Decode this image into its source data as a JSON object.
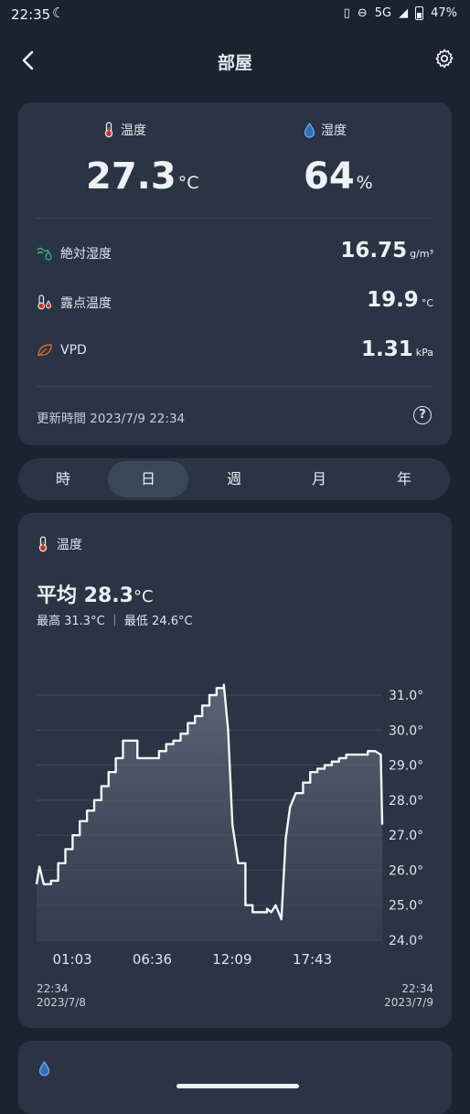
{
  "status": {
    "time": "22:35",
    "network": "5G",
    "battery": "47%"
  },
  "appbar": {
    "title": "部屋"
  },
  "summary": {
    "temp_label": "温度",
    "temp_value": "27.3",
    "temp_unit": "°C",
    "hum_label": "湿度",
    "hum_value": "64",
    "hum_unit": "%",
    "rows": [
      {
        "label": "絶対湿度",
        "value": "16.75",
        "unit": "g/m³"
      },
      {
        "label": "露点温度",
        "value": "19.9",
        "unit": "°C"
      },
      {
        "label": "VPD",
        "value": "1.31",
        "unit": "kPa"
      }
    ],
    "updated": "更新時間 2023/7/9 22:34",
    "help": "?"
  },
  "tabs": [
    {
      "label": "時",
      "active": false
    },
    {
      "label": "日",
      "active": true
    },
    {
      "label": "週",
      "active": false
    },
    {
      "label": "月",
      "active": false
    },
    {
      "label": "年",
      "active": false
    }
  ],
  "chart_card": {
    "label": "温度",
    "avg_label": "平均 28.3",
    "avg_unit": "°C",
    "minmax": "最高 31.3°C ｜ 最低 24.6°C",
    "range_start_time": "22:34",
    "range_start_date": "2023/7/8",
    "range_end_time": "22:34",
    "range_end_date": "2023/7/9"
  },
  "chart_data": {
    "type": "area",
    "ylim": [
      24.0,
      31.0
    ],
    "yticks": [
      "31.0°",
      "30.0°",
      "29.0°",
      "28.0°",
      "27.0°",
      "26.0°",
      "25.0°",
      "24.0°"
    ],
    "xticks": [
      "01:03",
      "06:36",
      "12:09",
      "17:43"
    ],
    "x_hours": [
      0,
      0.2,
      0.5,
      1,
      1.5,
      2,
      2.5,
      3,
      3.5,
      4,
      4.5,
      5,
      5.5,
      6,
      6.5,
      7,
      7.5,
      8,
      8.5,
      9,
      9.5,
      10,
      10.5,
      11,
      11.5,
      12,
      12.5,
      13,
      13.3,
      13.6,
      14,
      14.5,
      15,
      15.5,
      16,
      16.3,
      16.6,
      17,
      17.3,
      17.6,
      18,
      18.5,
      19,
      19.5,
      20,
      20.5,
      21,
      21.5,
      22,
      22.5,
      23,
      23.5,
      23.9,
      24
    ],
    "values": [
      25.6,
      26.1,
      25.6,
      25.7,
      26.2,
      26.6,
      27.0,
      27.4,
      27.7,
      28.0,
      28.4,
      28.8,
      29.2,
      29.7,
      29.7,
      29.2,
      29.2,
      29.2,
      29.4,
      29.6,
      29.7,
      29.9,
      30.2,
      30.4,
      30.7,
      31.0,
      31.2,
      31.3,
      30.0,
      27.3,
      26.2,
      25.0,
      24.8,
      24.8,
      24.9,
      24.8,
      25.0,
      24.6,
      26.9,
      27.8,
      28.2,
      28.5,
      28.8,
      28.9,
      29.0,
      29.1,
      29.2,
      29.3,
      29.3,
      29.3,
      29.4,
      29.4,
      29.3,
      27.3
    ]
  }
}
